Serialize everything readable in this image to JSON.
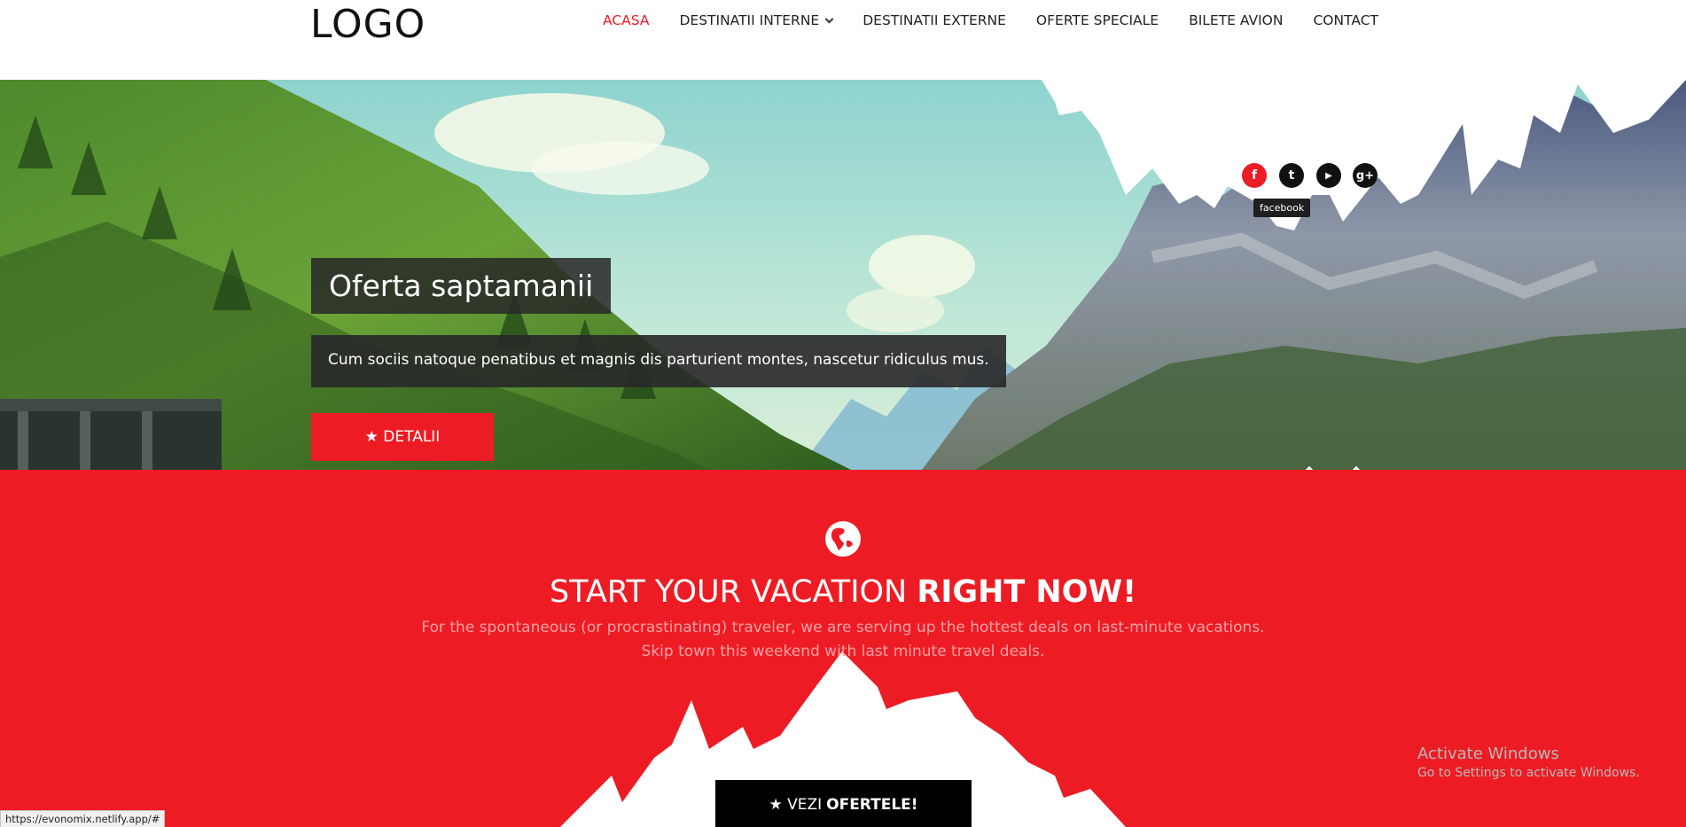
{
  "header": {
    "logo": "LOGO",
    "nav": [
      {
        "label": "ACASA",
        "active": true
      },
      {
        "label": "DESTINATII INTERNE",
        "has_dropdown": true
      },
      {
        "label": "DESTINATII EXTERNE"
      },
      {
        "label": "OFERTE SPECIALE"
      },
      {
        "label": "BILETE AVION"
      },
      {
        "label": "CONTACT"
      }
    ]
  },
  "hero": {
    "social": [
      {
        "name": "facebook-icon",
        "glyph": "f"
      },
      {
        "name": "twitter-icon",
        "glyph": "t"
      },
      {
        "name": "youtube-icon",
        "glyph": "▶"
      },
      {
        "name": "googleplus-icon",
        "glyph": "g+"
      }
    ],
    "tooltip": "facebook",
    "title": "Oferta saptamanii",
    "text": "Cum sociis natoque penatibus et magnis dis parturient montes, nascetur ridiculus mus.",
    "button_label": "★ DETALII"
  },
  "promo": {
    "title_regular": "START YOUR VACATION ",
    "title_bold": "RIGHT NOW!",
    "desc_line1": "For the spontaneous (or procrastinating) traveler, we are serving up the hottest deals on last-minute vacations.",
    "desc_line2": "Skip town this weekend with last minute travel deals.",
    "button_prefix": "★ VEZI",
    "button_bold": "OFERTELE!"
  },
  "overlay": {
    "activate_line1": "Activate Windows",
    "activate_line2": "Go to Settings to activate Windows.",
    "status_url": "https://evonomix.netlify.app/#"
  },
  "colors": {
    "accent": "#ed1c24",
    "dark_box": "#282828"
  }
}
